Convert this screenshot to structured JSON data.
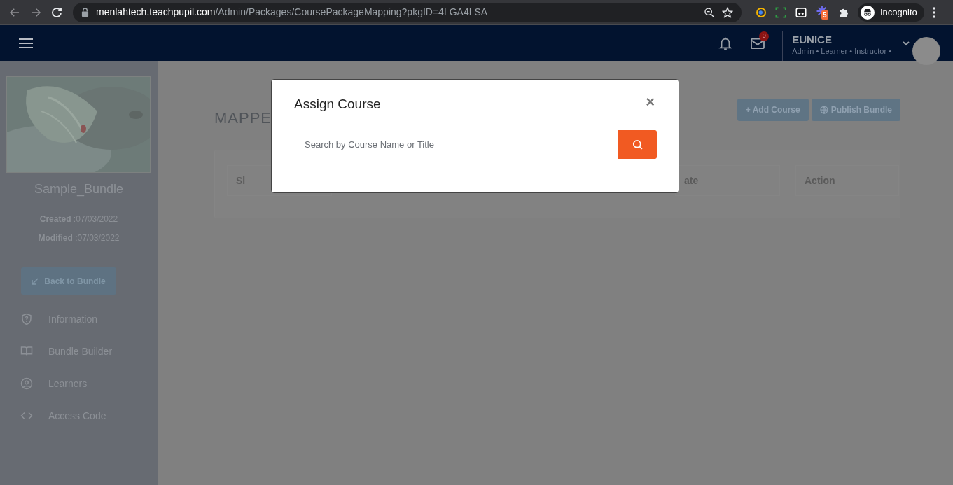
{
  "browser": {
    "url": "**menlahtech.teachpupil.com**/Admin/Packages/CoursePackageMapping?pkgID=4LGA4LSA",
    "extension_badge": "5",
    "profile_label": "Incognito"
  },
  "header": {
    "mail_count": "0",
    "user_name": "EUNICE",
    "user_roles": "Admin • Learner • Instructor •"
  },
  "sidebar": {
    "bundle_name": "Sample_Bundle",
    "created": "**Created** :07/03/2022",
    "modified": "**Modified** :07/03/2022",
    "back_button": "Back to Bundle",
    "items": [
      {
        "kind": "shield",
        "label": "Information"
      },
      {
        "kind": "book",
        "label": "Bundle Builder"
      },
      {
        "kind": "user",
        "label": "Learners"
      },
      {
        "kind": "code",
        "label": "Access Code"
      }
    ]
  },
  "main": {
    "title": "MAPPE",
    "buttons": [
      {
        "kind": "add",
        "label": "+ Add Course"
      },
      {
        "kind": "globe",
        "label": "Publish Bundle"
      }
    ],
    "table": {
      "columns": [
        {
          "label": "Sl"
        },
        {
          "label": "ate"
        },
        {
          "label": "Action"
        }
      ]
    }
  },
  "modal": {
    "title": "Assign Course",
    "close": "×",
    "search": {
      "placeholder": "Search by Course Name or Title"
    }
  }
}
